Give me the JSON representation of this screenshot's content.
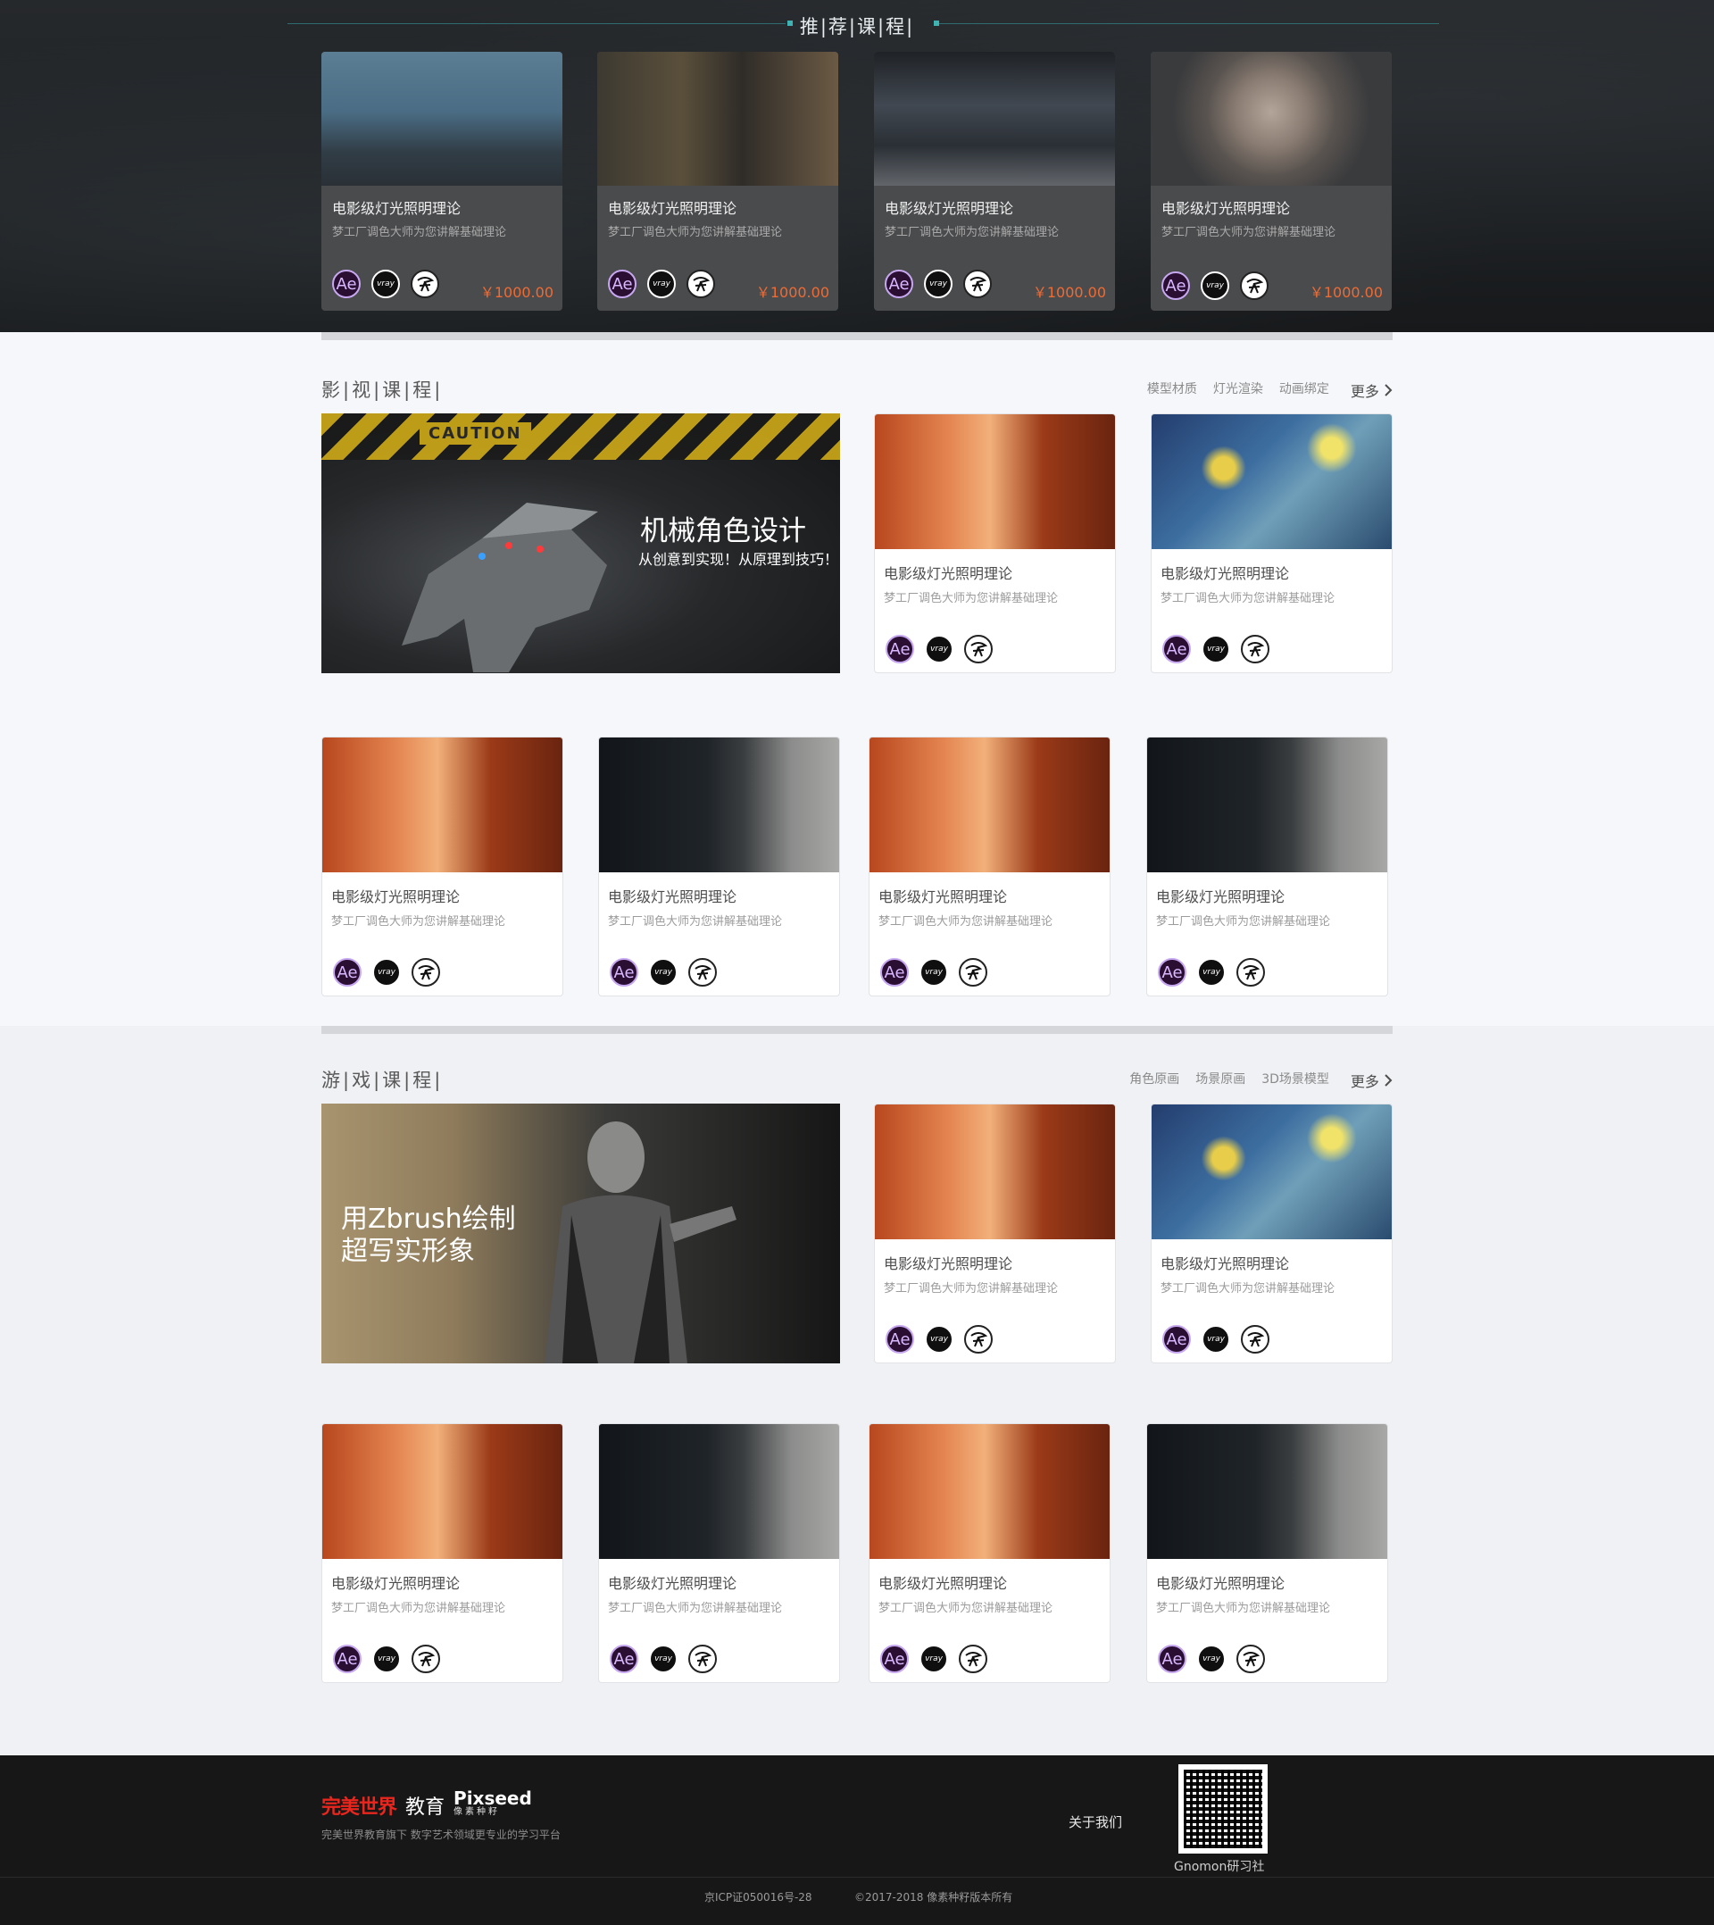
{
  "recommended": {
    "title": "推|荐|课|程|",
    "cards": [
      {
        "title": "电影级灯光照明理论",
        "subtitle": "梦工厂调色大师为您讲解基础理论",
        "price": "￥1000.00",
        "image": "car-rider-scene"
      },
      {
        "title": "电影级灯光照明理论",
        "subtitle": "梦工厂调色大师为您讲解基础理论",
        "price": "￥1000.00",
        "image": "alley-scene"
      },
      {
        "title": "电影级灯光照明理论",
        "subtitle": "梦工厂调色大师为您讲解基础理论",
        "price": "￥1000.00",
        "image": "spaceship-scene"
      },
      {
        "title": "电影级灯光照明理论",
        "subtitle": "梦工厂调色大师为您讲解基础理论",
        "price": "￥1000.00",
        "image": "bald-head-portrait"
      }
    ]
  },
  "film": {
    "title": "影|视|课|程|",
    "tags": [
      "模型材质",
      "灯光渲染",
      "动画绑定"
    ],
    "more": "更多",
    "banner": {
      "title": "机械角色设计",
      "subtitle": "从创意到实现！从原理到技巧！",
      "caution": "CAUTION"
    },
    "cards": [
      {
        "title": "电影级灯光照明理论",
        "subtitle": "梦工厂调色大师为您讲解基础理论"
      },
      {
        "title": "电影级灯光照明理论",
        "subtitle": "梦工厂调色大师为您讲解基础理论"
      },
      {
        "title": "电影级灯光照明理论",
        "subtitle": "梦工厂调色大师为您讲解基础理论"
      },
      {
        "title": "电影级灯光照明理论",
        "subtitle": "梦工厂调色大师为您讲解基础理论"
      },
      {
        "title": "电影级灯光照明理论",
        "subtitle": "梦工厂调色大师为您讲解基础理论"
      },
      {
        "title": "电影级灯光照明理论",
        "subtitle": "梦工厂调色大师为您讲解基础理论"
      }
    ]
  },
  "game": {
    "title": "游|戏|课|程|",
    "tags": [
      "角色原画",
      "场景原画",
      "3D场景模型"
    ],
    "more": "更多",
    "banner": {
      "title": "用Zbrush绘制",
      "title2": "超写实形象"
    },
    "cards": [
      {
        "title": "电影级灯光照明理论",
        "subtitle": "梦工厂调色大师为您讲解基础理论"
      },
      {
        "title": "电影级灯光照明理论",
        "subtitle": "梦工厂调色大师为您讲解基础理论"
      },
      {
        "title": "电影级灯光照明理论",
        "subtitle": "梦工厂调色大师为您讲解基础理论"
      },
      {
        "title": "电影级灯光照明理论",
        "subtitle": "梦工厂调色大师为您讲解基础理论"
      },
      {
        "title": "电影级灯光照明理论",
        "subtitle": "梦工厂调色大师为您讲解基础理论"
      },
      {
        "title": "电影级灯光照明理论",
        "subtitle": "梦工厂调色大师为您讲解基础理论"
      }
    ]
  },
  "software_icons": {
    "ae": "Ae",
    "vray": "vray",
    "zbrush": "zbrush-icon"
  },
  "footer": {
    "logo_pw": "完美世界",
    "logo_edu": "教育",
    "logo_pixseed": "Pixseed",
    "logo_pixseed_cn": "像素种籽",
    "tagline": "完美世界教育旗下 数字艺术领域更专业的学习平台",
    "about": "关于我们",
    "qr_caption": "Gnomon研习社",
    "icp": "京ICP证050016号-28",
    "copyright": "©2017-2018 像素种籽版本所有"
  },
  "colors": {
    "accent_price": "#ee6b34",
    "teal_line": "#3fb3b4",
    "footer_bg": "#171717"
  }
}
